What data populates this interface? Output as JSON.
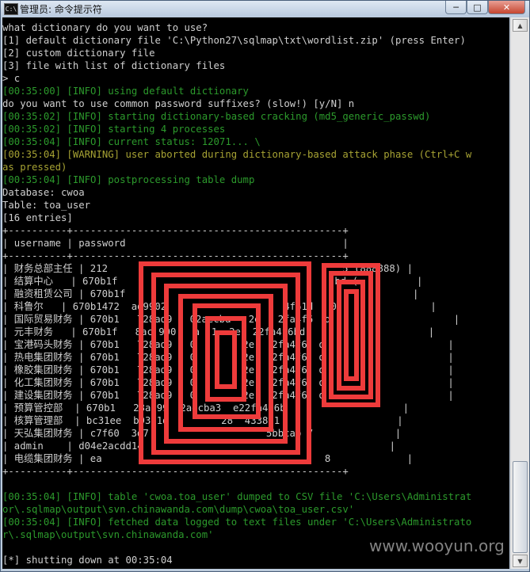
{
  "window": {
    "title": "管理员: 命令提示符",
    "icon": "cmd-icon"
  },
  "window_controls": {
    "minimize": "─",
    "maximize": "□",
    "close": "✕"
  },
  "console": {
    "lines": [
      {
        "text": "what dictionary do you want to use?",
        "color": "white"
      },
      {
        "text": "[1] default dictionary file 'C:\\Python27\\sqlmap\\txt\\wordlist.zip' (press Enter)",
        "color": "white"
      },
      {
        "text": "[2] custom dictionary file",
        "color": "white"
      },
      {
        "text": "[3] file with list of dictionary files",
        "color": "white"
      },
      {
        "text": "> c",
        "color": "white"
      },
      {
        "text": "[00:35:00] [INFO] using default dictionary",
        "color": "green"
      },
      {
        "text": "do you want to use common password suffixes? (slow!) [y/N] n",
        "color": "white"
      },
      {
        "text": "[00:35:02] [INFO] starting dictionary-based cracking (md5_generic_passwd)",
        "color": "green"
      },
      {
        "text": "[00:35:02] [INFO] starting 4 processes",
        "color": "green"
      },
      {
        "text": "[00:35:04] [INFO] current status: 12071... \\",
        "color": "green"
      },
      {
        "text": "[00:35:04] [WARNING] user aborted during dictionary-based attack phase (Ctrl+C w",
        "color": "yellow"
      },
      {
        "text": "as pressed)",
        "color": "yellow"
      },
      {
        "text": "[00:35:04] [INFO] postprocessing table dump",
        "color": "green"
      },
      {
        "text": "Database: cwoa",
        "color": "white"
      },
      {
        "text": "Table: toa_user",
        "color": "white"
      },
      {
        "text": "[16 entries]",
        "color": "white"
      },
      {
        "text": "+----------+----------------------------------------------+",
        "color": "white"
      },
      {
        "text": "| username | password                                     |",
        "color": "white"
      },
      {
        "text": "+----------+----------------------------------------------+",
        "color": "white"
      },
      {
        "text": "| 财务总部主任 | 212                                        5 (888888) |",
        "color": "white"
      },
      {
        "text": "| 结算中心   | 670b1f                                     bd (          |",
        "color": "white"
      },
      {
        "text": "| 融资租赁公司 | 670b1f                                                 |",
        "color": "white"
      },
      {
        "text": "| 科鲁尔   | 670b1472  ad9902                    4f61d   0                |",
        "color": "white"
      },
      {
        "text": "| 国际贸易财务 | 670b1   728ad9   02aecba   2e   2fa4f6  d                     |",
        "color": "white"
      },
      {
        "text": "| 元丰财务   | 670b1f   8ac 990   a  1  2e  22fa4f6bd                     |",
        "color": "white"
      },
      {
        "text": "| 宝港码头财务 | 670b1   728ad9   0        2e   2fa4f6  d                     |",
        "color": "white"
      },
      {
        "text": "| 热电集团财务 | 670b1   728ad9   0        2e   2fa4f6  d                     |",
        "color": "white"
      },
      {
        "text": "| 橡胶集团财务 | 670b1   728ad9   0        2e   2fa4f6  d                     |",
        "color": "white"
      },
      {
        "text": "| 化工集团财务 | 670b1   728ad9   0        2e   2fa4f6  d                     |",
        "color": "white"
      },
      {
        "text": "| 建设集团财务 | 670b1   728ad9   0        2e   2fa4f6  d                     |",
        "color": "white"
      },
      {
        "text": "| 预算管控部  | 670b1   28ad99  2aecba3  e22fa4f6b                    |",
        "color": "white"
      },
      {
        "text": "| 核算管理部  | bc31ee  b9301d         28  433851                    |",
        "color": "white"
      },
      {
        "text": "| 天弘集团财务 | c7f60  3d7                    5bbcab 7              |",
        "color": "white"
      },
      {
        "text": "| admin    | d04e2acdd14                                          |",
        "color": "white"
      },
      {
        "text": "| 电缆集团财务 | ea                                      8             |",
        "color": "white"
      },
      {
        "text": "+----------+----------------------------------------------+",
        "color": "white"
      },
      {
        "text": "",
        "color": "white"
      },
      {
        "text": "[00:35:04] [INFO] table 'cwoa.toa_user' dumped to CSV file 'C:\\Users\\Administrat",
        "color": "green"
      },
      {
        "text": "or\\.sqlmap\\output\\svn.chinawanda.com\\dump\\cwoa\\toa_user.csv'",
        "color": "green"
      },
      {
        "text": "[00:35:04] [INFO] fetched data logged to text files under 'C:\\Users\\Administrato",
        "color": "green"
      },
      {
        "text": "r\\.sqlmap\\output\\svn.chinawanda.com'",
        "color": "green"
      },
      {
        "text": "",
        "color": "white"
      },
      {
        "text": "[*] shutting down at 00:35:04",
        "color": "white"
      }
    ]
  },
  "scrollbar": {
    "up_arrow": "▲",
    "down_arrow": "▼"
  },
  "watermark": "www.wooyun.org",
  "colors": {
    "console_bg": "#000000",
    "text_white": "#cfcfcf",
    "text_green": "#2c9a2c",
    "text_yellow": "#a6a233",
    "redaction": "#ee3b3b"
  }
}
